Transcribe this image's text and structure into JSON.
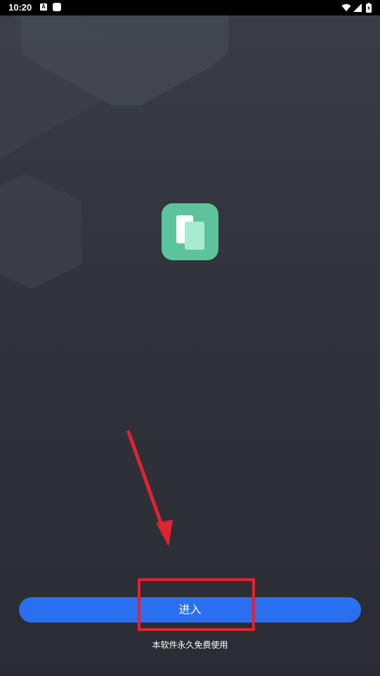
{
  "status_bar": {
    "time": "10:20",
    "notification_icons": [
      "a-icon",
      "square-icon"
    ],
    "system_icons": [
      "wifi-icon",
      "signal-icon",
      "battery-icon"
    ]
  },
  "app": {
    "logo_icon": "cards-icon",
    "logo_color": "#5cc49c"
  },
  "enter_button": {
    "label": "进入",
    "color": "#2a6ff0"
  },
  "footer": {
    "note": "本软件永久免费使用"
  },
  "annotations": {
    "arrow_color": "#e0232f",
    "highlight_color": "#e0232f"
  }
}
